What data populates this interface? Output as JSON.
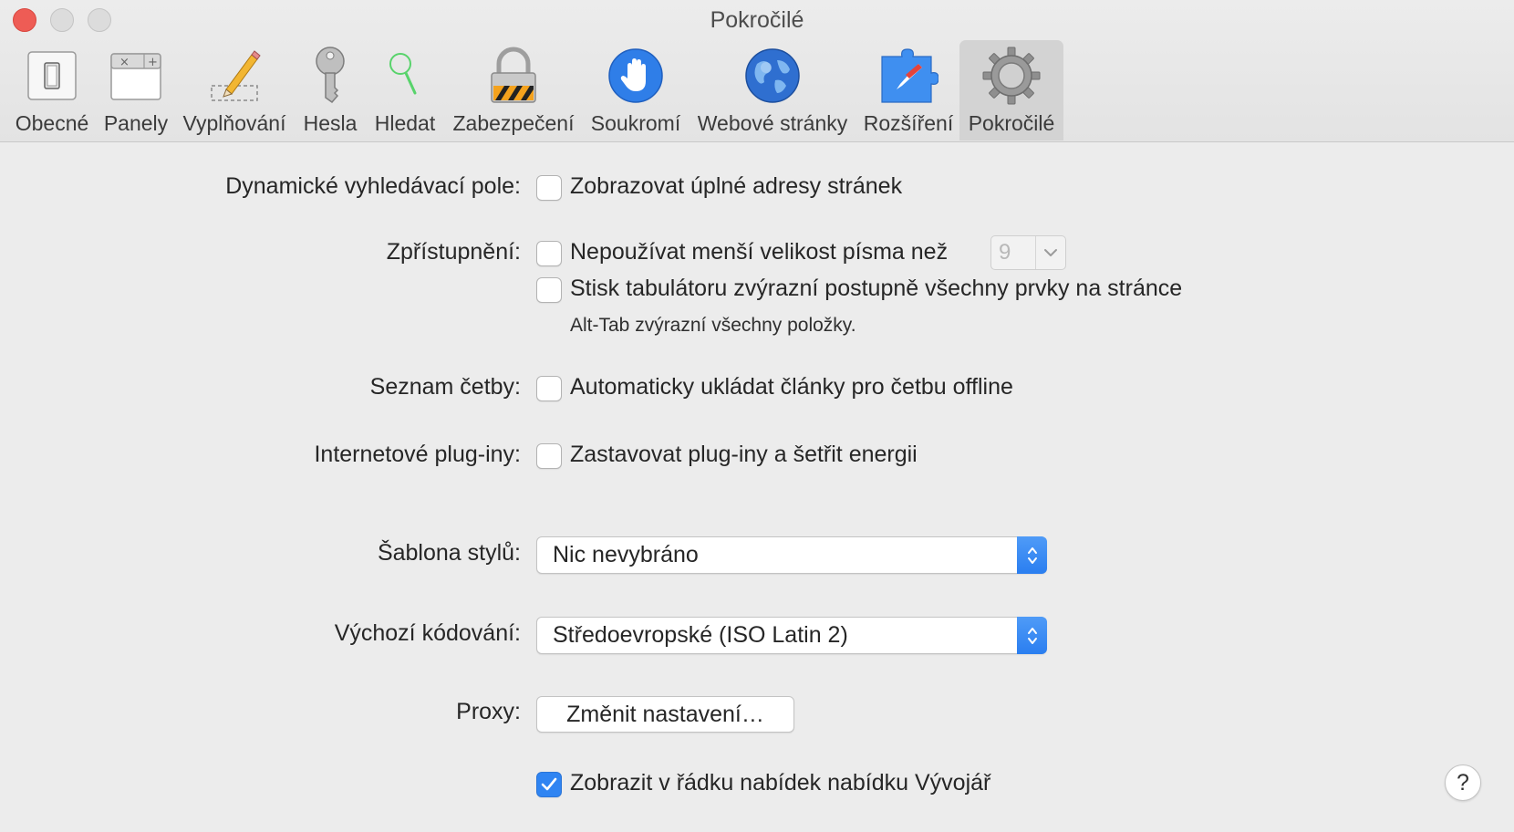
{
  "window": {
    "title": "Pokročilé"
  },
  "toolbar": {
    "tabs": [
      {
        "label": "Obecné"
      },
      {
        "label": "Panely"
      },
      {
        "label": "Vyplňování"
      },
      {
        "label": "Hesla"
      },
      {
        "label": "Hledat"
      },
      {
        "label": "Zabezpečení"
      },
      {
        "label": "Soukromí"
      },
      {
        "label": "Webové stránky"
      },
      {
        "label": "Rozšíření"
      },
      {
        "label": "Pokročilé",
        "selected": true
      }
    ]
  },
  "settings": {
    "smart_search": {
      "label": "Dynamické vyhledávací pole:",
      "show_full_address": {
        "text": "Zobrazovat úplné adresy stránek",
        "checked": false
      }
    },
    "accessibility": {
      "label": "Zpřístupnění:",
      "min_font": {
        "text": "Nepoužívat menší velikost písma než",
        "checked": false,
        "value": "9"
      },
      "tab_highlight": {
        "text": "Stisk tabulátoru zvýrazní postupně všechny prvky na stránce",
        "checked": false
      },
      "note": "Alt-Tab zvýrazní všechny položky."
    },
    "reading_list": {
      "label": "Seznam četby:",
      "save_offline": {
        "text": "Automaticky ukládat články pro četbu offline",
        "checked": false
      }
    },
    "plugins": {
      "label": "Internetové plug-iny:",
      "stop_plugins": {
        "text": "Zastavovat plug-iny a šetřit energii",
        "checked": false
      }
    },
    "style_sheet": {
      "label": "Šablona stylů:",
      "value": "Nic nevybráno"
    },
    "encoding": {
      "label": "Výchozí kódování:",
      "value": "Středoevropské (ISO Latin 2)"
    },
    "proxy": {
      "label": "Proxy:",
      "button": "Změnit nastavení…"
    },
    "develop_menu": {
      "text": "Zobrazit v řádku nabídek nabídku Vývojář",
      "checked": true
    }
  },
  "help": {
    "label": "?"
  },
  "colors": {
    "accent": "#2f84f2",
    "close": "#ee5c55",
    "background": "#ececec"
  }
}
